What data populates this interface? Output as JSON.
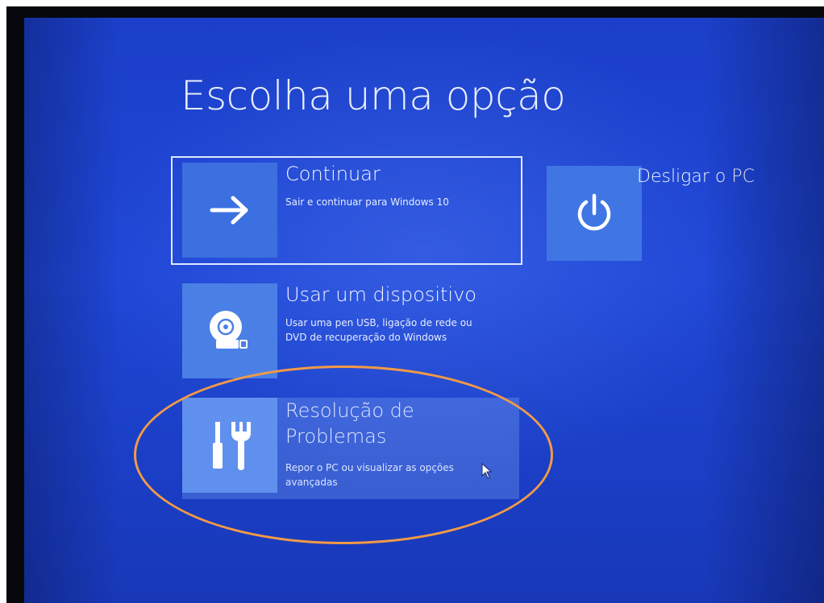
{
  "screen": {
    "title": "Escolha uma opção"
  },
  "options": [
    {
      "id": "continue",
      "icon": "arrow-right-icon",
      "heading": "Continuar",
      "description": "Sair e continuar para Windows 10"
    },
    {
      "id": "use-device",
      "icon": "disc-drive-icon",
      "heading": "Usar um dispositivo",
      "description_lines": [
        "Usar uma pen USB, ligação de rede ou",
        "DVD de recuperação do Windows"
      ]
    },
    {
      "id": "troubleshoot",
      "icon": "tools-icon",
      "heading": "Resolução de Problemas",
      "description": "Repor o PC ou visualizar as opções avançadas"
    },
    {
      "id": "shutdown",
      "icon": "power-icon",
      "heading": "Desligar o PC"
    }
  ],
  "colors": {
    "background": "#1e46d6",
    "tile": "#3f74e3",
    "annotation": "#f39a45"
  }
}
